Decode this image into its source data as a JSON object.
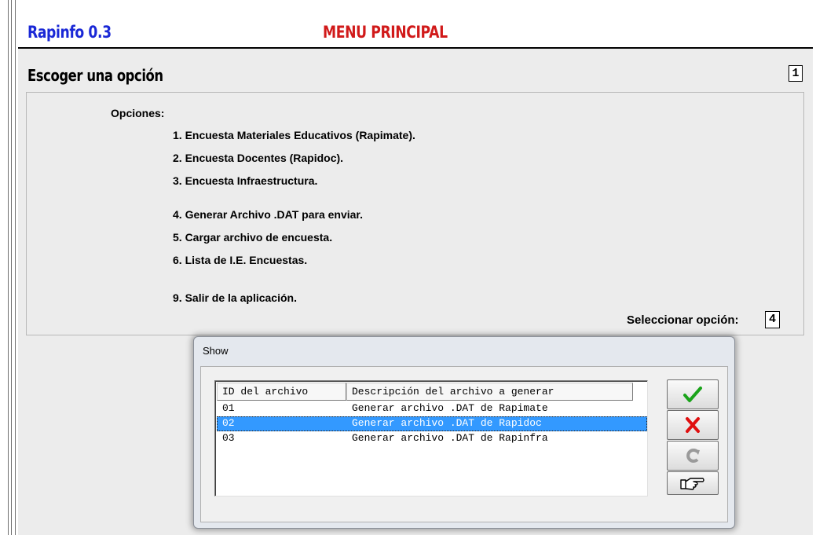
{
  "app": {
    "name": "Rapinfo 0.3",
    "menu_title": "MENU PRINCIPAL",
    "section_title": "Escoger una opción",
    "page_number": "1"
  },
  "options": {
    "heading": "Opciones:",
    "items": [
      "1. Encuesta Materiales Educativos (Rapimate).",
      "2. Encuesta Docentes (Rapidoc).",
      "3. Encuesta Infraestructura.",
      "4. Generar Archivo .DAT para enviar.",
      "5. Cargar archivo de encuesta.",
      "6. Lista de I.E. Encuestas.",
      "9. Salir de la aplicación."
    ],
    "select_label": "Seleccionar opción:",
    "select_value": "4"
  },
  "dialog": {
    "title": "Show",
    "columns": [
      "ID del archivo",
      "Descripción del archivo a generar"
    ],
    "rows": [
      {
        "id": "01",
        "desc": "Generar archivo .DAT de Rapimate"
      },
      {
        "id": "02",
        "desc": "Generar archivo .DAT de Rapidoc"
      },
      {
        "id": "03",
        "desc": "Generar archivo .DAT de Rapinfra"
      }
    ],
    "selected_row": 1,
    "buttons": [
      {
        "name": "accept",
        "icon": "checkmark-icon",
        "color": "#1aa31a"
      },
      {
        "name": "cancel",
        "icon": "x-cross-icon",
        "color": "#e01010"
      },
      {
        "name": "refresh",
        "icon": "refresh-icon",
        "color": "#9a9a9a"
      },
      {
        "name": "pointer",
        "icon": "pointing-hand-icon",
        "color": "#000000"
      }
    ]
  }
}
